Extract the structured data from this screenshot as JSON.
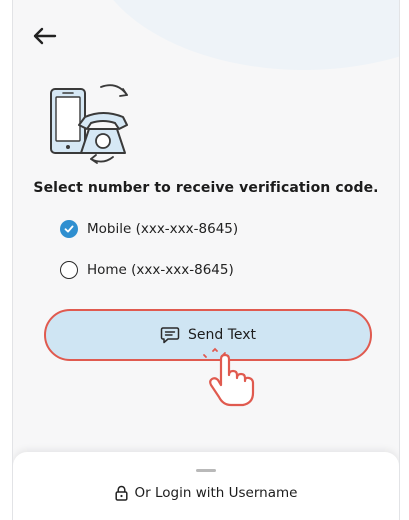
{
  "screen": {
    "back_icon": "arrow-left-icon",
    "illustration_icon": "phone-call-illustration-icon",
    "heading": "Select number to receive verification code."
  },
  "options": [
    {
      "label": "Mobile (xxx-xxx-8645)",
      "selected": true
    },
    {
      "label": "Home (xxx-xxx-8645)",
      "selected": false
    }
  ],
  "send_button": {
    "label": "Send Text",
    "icon": "message-icon",
    "highlight_color": "#e05a4f",
    "fill_color": "#cfe5f3"
  },
  "bottom_sheet": {
    "login_label": "Or Login with Username",
    "icon": "lock-icon"
  },
  "colors": {
    "accent": "#2f8fd0"
  }
}
